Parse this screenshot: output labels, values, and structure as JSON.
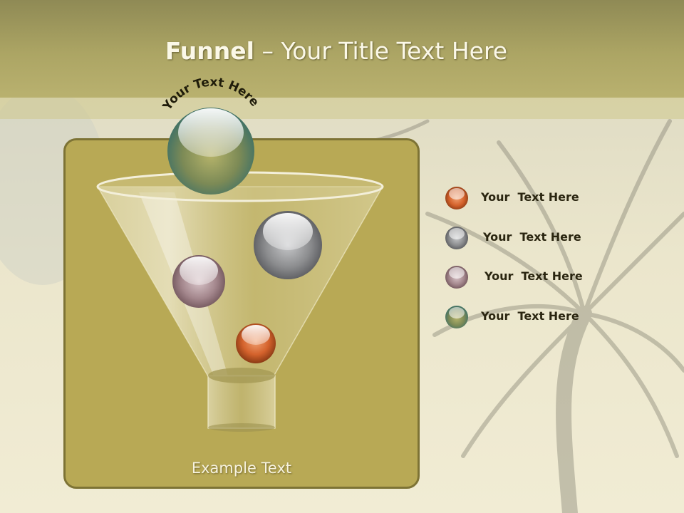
{
  "slide": {
    "title_bold": "Funnel",
    "title_rest": " – Your Title Text Here",
    "arc_text": "Your Text Here",
    "example_text": "Example Text"
  },
  "legend": [
    {
      "label": "Your  Text Here",
      "color": "#d4622c"
    },
    {
      "label": "Your  Text Here",
      "color": "#8b8c8e"
    },
    {
      "label": "Your  Text Here",
      "color": "#a3868c"
    },
    {
      "label": "Your  Text Here",
      "color": "#3f7b74"
    }
  ],
  "colors": {
    "title_band": "#aca564",
    "panel": "#b8a955",
    "panel_border": "#7d7335",
    "orange_ball": "#d4622c",
    "gray_ball": "#8b8c8e",
    "mauve_ball": "#a3868c",
    "teal_ball": "#3f7b74"
  }
}
